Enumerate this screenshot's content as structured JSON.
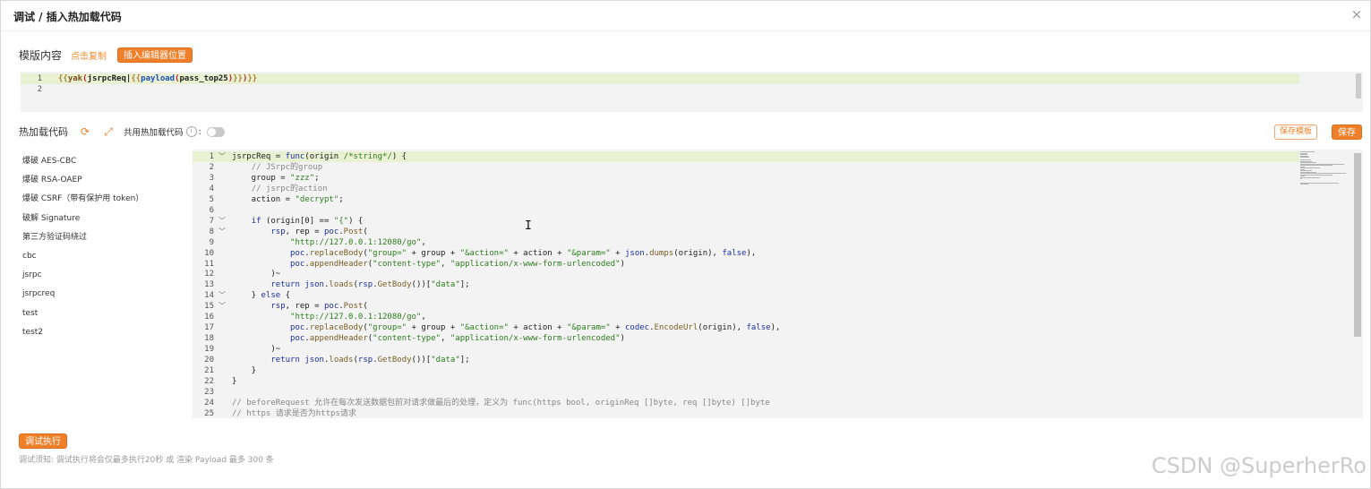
{
  "modal": {
    "title": "调试 / 插入热加载代码",
    "close": "×"
  },
  "template": {
    "label": "模版内容",
    "copy_link": "点击复制",
    "insert_button": "插入编辑器位置",
    "lines": [
      {
        "num": "1",
        "code": "{{yak(jsrpcReq|{{payload(pass_top25)}})}}"
      },
      {
        "num": "2",
        "code": ""
      }
    ]
  },
  "hotload": {
    "label": "热加载代码",
    "refresh_icon": "refresh-icon",
    "expand_icon": "expand-icon",
    "shared_label": "共用热加载代码",
    "info_icon": "info-icon",
    "colon": ":",
    "shared_enabled": false,
    "save_template_button": "保存模板",
    "save_button": "保存"
  },
  "sidebar": {
    "items": [
      "爆破 AES-CBC",
      "爆破 RSA-OAEP",
      "爆破 CSRF（带有保护用 token）",
      "破解 Signature",
      "第三方验证码绕过",
      "cbc",
      "jsrpc",
      "jsrpcreq",
      "test",
      "test2"
    ]
  },
  "editor": {
    "lines": [
      {
        "num": "1",
        "fold": "﹀",
        "code": "jsrpcReq = func(origin /*string*/) {"
      },
      {
        "num": "2",
        "fold": "",
        "code": "    // JSrpc的group"
      },
      {
        "num": "3",
        "fold": "",
        "code": "    group = \"zzz\";"
      },
      {
        "num": "4",
        "fold": "",
        "code": "    // jsrpc的action"
      },
      {
        "num": "5",
        "fold": "",
        "code": "    action = \"decrypt\";"
      },
      {
        "num": "6",
        "fold": "",
        "code": ""
      },
      {
        "num": "7",
        "fold": "﹀",
        "code": "    if (origin[0] == \"{\") {"
      },
      {
        "num": "8",
        "fold": "﹀",
        "code": "        rsp, rep = poc.Post("
      },
      {
        "num": "9",
        "fold": "",
        "code": "            \"http://127.0.0.1:12080/go\","
      },
      {
        "num": "10",
        "fold": "",
        "code": "            poc.replaceBody(\"group=\" + group + \"&action=\" + action + \"&param=\" + json.dumps(origin), false),"
      },
      {
        "num": "11",
        "fold": "",
        "code": "            poc.appendHeader(\"content-type\", \"application/x-www-form-urlencoded\")"
      },
      {
        "num": "12",
        "fold": "",
        "code": "        )~"
      },
      {
        "num": "13",
        "fold": "",
        "code": "        return json.loads(rsp.GetBody())[\"data\"];"
      },
      {
        "num": "14",
        "fold": "﹀",
        "code": "    } else {"
      },
      {
        "num": "15",
        "fold": "﹀",
        "code": "        rsp, rep = poc.Post("
      },
      {
        "num": "16",
        "fold": "",
        "code": "            \"http://127.0.0.1:12080/go\","
      },
      {
        "num": "17",
        "fold": "",
        "code": "            poc.replaceBody(\"group=\" + group + \"&action=\" + action + \"&param=\" + codec.EncodeUrl(origin), false),"
      },
      {
        "num": "18",
        "fold": "",
        "code": "            poc.appendHeader(\"content-type\", \"application/x-www-form-urlencoded\")"
      },
      {
        "num": "19",
        "fold": "",
        "code": "        )~"
      },
      {
        "num": "20",
        "fold": "",
        "code": "        return json.loads(rsp.GetBody())[\"data\"];"
      },
      {
        "num": "21",
        "fold": "",
        "code": "    }"
      },
      {
        "num": "22",
        "fold": "",
        "code": "}"
      },
      {
        "num": "23",
        "fold": "",
        "code": ""
      },
      {
        "num": "24",
        "fold": "",
        "code": "// beforeRequest 允许在每次发送数据包前对请求做最后的处理，定义为 func(https bool, originReq []byte, req []byte) []byte"
      },
      {
        "num": "25",
        "fold": "",
        "code": "// https 请求是否为https请求"
      }
    ]
  },
  "footer": {
    "run_button": "调试执行",
    "note": "调试须知: 调试执行将会仅最多执行20秒 或 渲染 Payload 最多 300 条"
  },
  "watermark": "CSDN @SuperherRo",
  "colors": {
    "accent": "#f07f2a",
    "highlight_line": "#eaf0d2",
    "editor_bg": "#f3f3f3"
  }
}
